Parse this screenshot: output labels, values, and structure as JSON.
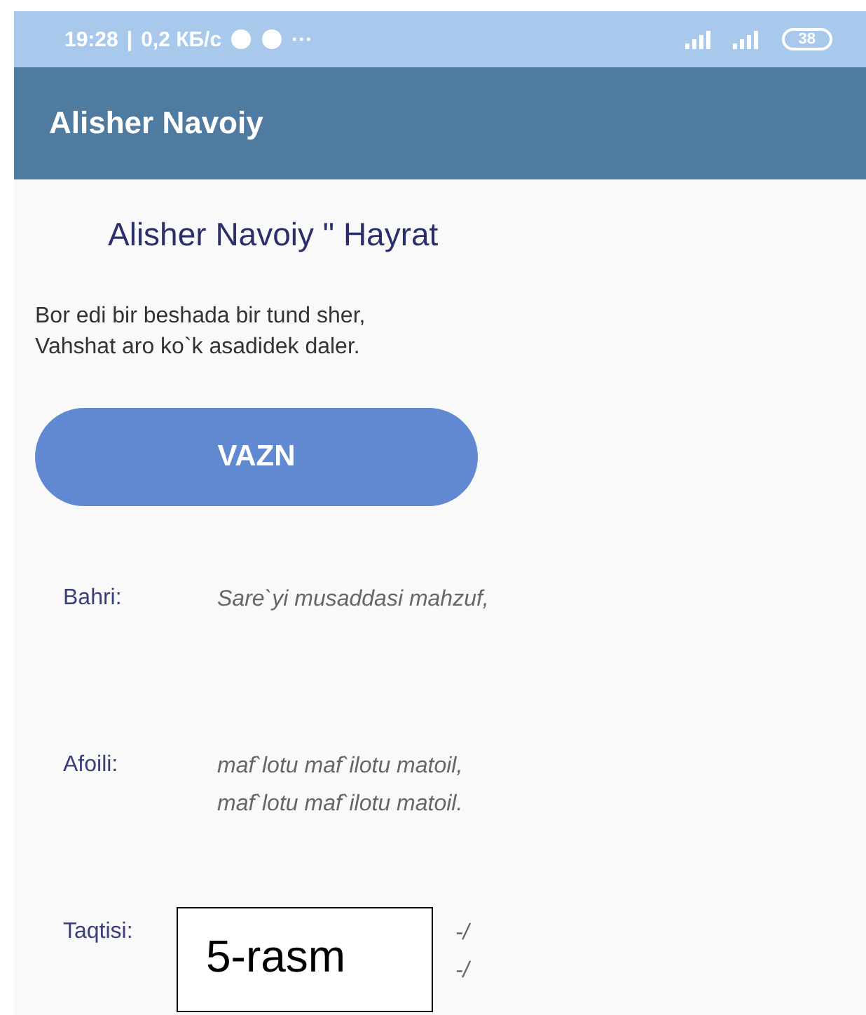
{
  "status_bar": {
    "time": "19:28",
    "separator": "|",
    "speed": "0,2 КБ/с",
    "more": "···",
    "battery": "38"
  },
  "app_bar": {
    "title": "Alisher Navoiy"
  },
  "heading": "Alisher Navoiy \" Hayrat",
  "poem": [
    "Bor edi bir beshada bir tund sher,",
    "Vahshat aro ko`k asadidek daler."
  ],
  "button": {
    "label": "VAZN"
  },
  "rows": [
    {
      "label": "Bahri:",
      "lines": [
        "Sare`yi musaddasi mahzuf,"
      ]
    },
    {
      "label": "Afoili:",
      "lines": [
        "maf`lotu maf`ilotu matoil,",
        "maf`lotu maf`ilotu matoil."
      ]
    },
    {
      "label": "Taqtisi:",
      "lines": [
        "-/",
        "-/"
      ]
    }
  ],
  "caption": "5-rasm"
}
